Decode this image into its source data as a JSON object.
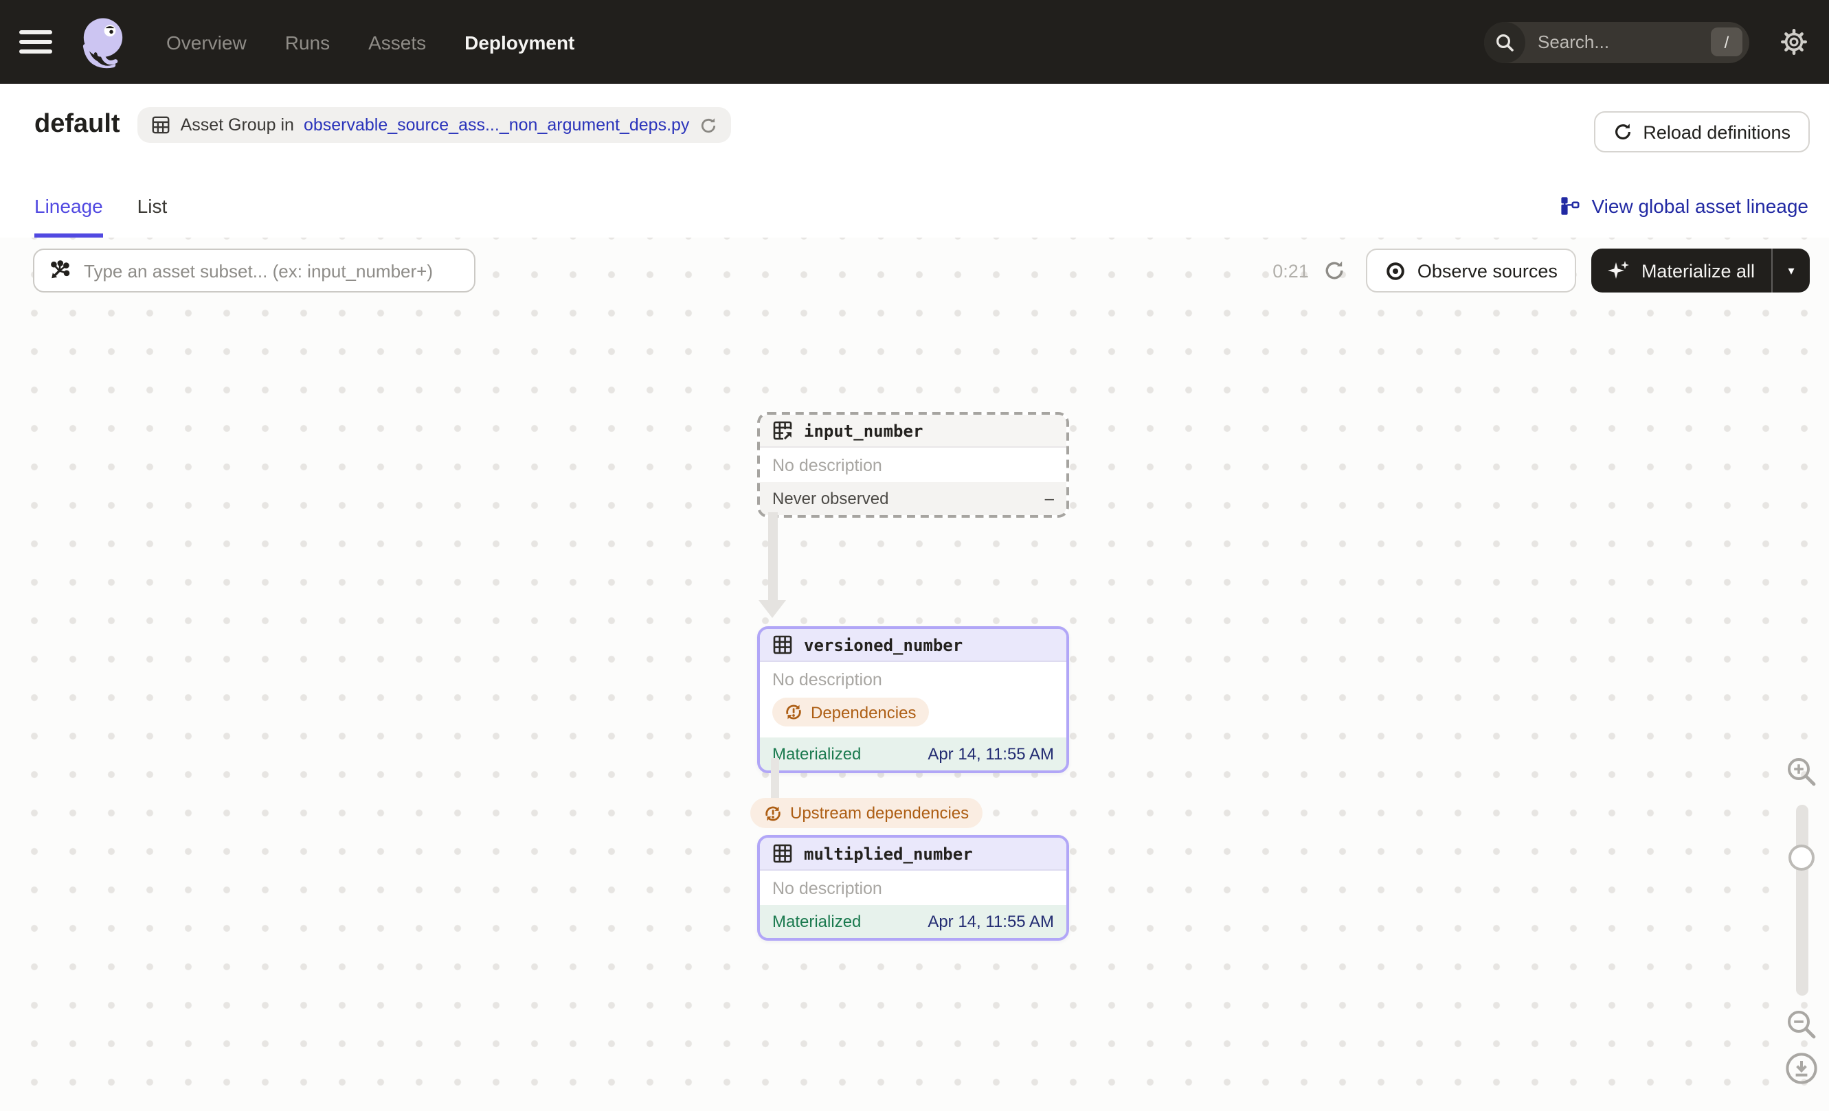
{
  "nav": {
    "links": [
      {
        "label": "Overview",
        "active": false
      },
      {
        "label": "Runs",
        "active": false
      },
      {
        "label": "Assets",
        "active": false
      },
      {
        "label": "Deployment",
        "active": true
      }
    ],
    "search_placeholder": "Search...",
    "search_shortcut": "/"
  },
  "header": {
    "title": "default",
    "group_label": "Asset Group in",
    "group_link": "observable_source_ass..._non_argument_deps.py",
    "reload_button": "Reload definitions"
  },
  "tabs": {
    "lineage": "Lineage",
    "list": "List",
    "view_global": "View global asset lineage"
  },
  "toolbar": {
    "subset_placeholder": "Type an asset subset... (ex: input_number+)",
    "timer": "0:21",
    "observe_button": "Observe sources",
    "materialize_button": "Materialize all",
    "caret": "▾"
  },
  "graph": {
    "edge_tag": "Upstream dependencies",
    "nodes": [
      {
        "name": "input_number",
        "description": "No description",
        "status": "Never observed",
        "value": "–"
      },
      {
        "name": "versioned_number",
        "description": "No description",
        "tag": "Dependencies",
        "status": "Materialized",
        "value": "Apr 14, 11:55 AM"
      },
      {
        "name": "multiplied_number",
        "description": "No description",
        "status": "Materialized",
        "value": "Apr 14, 11:55 AM"
      }
    ]
  },
  "colors": {
    "topbar_bg": "#211f1c",
    "accent_purple": "#5149e1",
    "link_blue": "#2b34bb",
    "global_link_navy": "#2129a3",
    "node_border_purple": "#b1a6f7",
    "node_header_purple": "#eae8fb",
    "materialized_green": "#1b7a4f",
    "materialized_bg": "#e7f2ec",
    "timestamp_navy": "#232c72",
    "tag_orange": "#ad5e14",
    "tag_orange_bg": "#faede2"
  }
}
